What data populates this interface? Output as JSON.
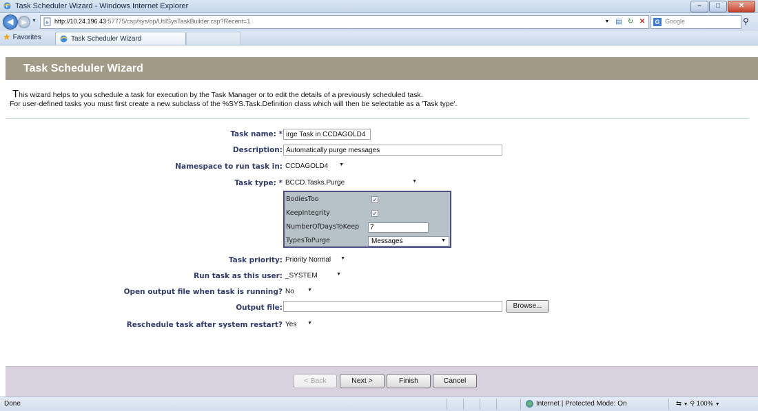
{
  "browser": {
    "window_title": "Task Scheduler Wizard - Windows Internet Explorer",
    "url_host": "http://10.24.196.43",
    "url_rest": ":57775/csp/sys/op/UtilSysTaskBuilder.csp?Recent=1",
    "search_engine": "Google",
    "favorites_label": "Favorites",
    "tab_title": "Task Scheduler Wizard",
    "window_buttons": [
      "–",
      "□",
      "✕"
    ],
    "status_text": "Done",
    "zone_text": "Internet | Protected Mode: On",
    "zoom_text": "100%"
  },
  "page": {
    "title": "Task Scheduler Wizard",
    "intro_first_letter": "T",
    "intro_line1_rest": "his wizard helps to you schedule a task for execution by the Task Manager or to edit the details of a previously scheduled task.",
    "intro_line2": "For user-defined tasks you must first create a new subclass of the %SYS.Task.Definition class which will then be selectable as a 'Task type'."
  },
  "form": {
    "task_name_label": "Task name: *",
    "task_name_value": "irge Task in CCDAGOLD4",
    "description_label": "Description:",
    "description_value": "Automatically purge messages",
    "namespace_label": "Namespace to run task in:",
    "namespace_value": "CCDAGOLD4",
    "task_type_label": "Task type: *",
    "task_type_value": "BCCD.Tasks.Purge",
    "properties": {
      "bodies_too_label": "BodiesToo",
      "bodies_too_checked": true,
      "keep_integrity_label": "KeepIntegrity",
      "keep_integrity_checked": true,
      "days_label": "NumberOfDaysToKeep",
      "days_value": "7",
      "types_label": "TypesToPurge",
      "types_value": "Messages"
    },
    "priority_label": "Task priority:",
    "priority_value": "Priority Normal",
    "run_as_label": "Run task as this user:",
    "run_as_value": "_SYSTEM",
    "open_output_label": "Open output file when task is running?",
    "open_output_value": "No",
    "output_file_label": "Output file:",
    "output_file_value": "",
    "browse_label": "Browse...",
    "reschedule_label": "Reschedule task after system restart?",
    "reschedule_value": "Yes"
  },
  "footer": {
    "back_label": "< Back",
    "next_label": "Next >",
    "finish_label": "Finish",
    "cancel_label": "Cancel"
  },
  "check_mark": "✓",
  "dropdown_arrow": "▼"
}
